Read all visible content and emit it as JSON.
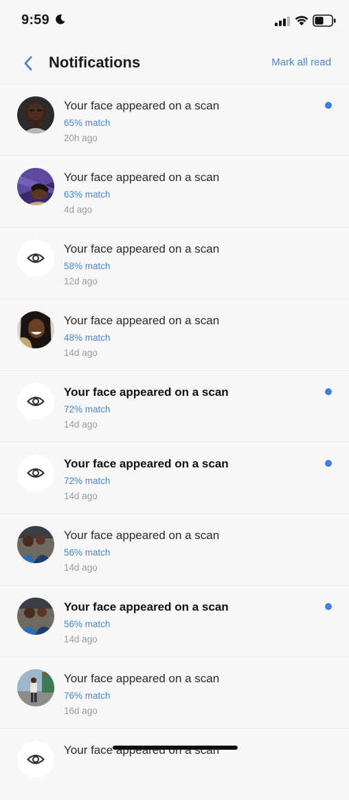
{
  "status_bar": {
    "time": "9:59"
  },
  "header": {
    "title": "Notifications",
    "mark_all_label": "Mark all read"
  },
  "colors": {
    "accent": "#4a86d9",
    "unread_dot": "#3d7fe0",
    "background": "#f7f7f8"
  },
  "notifications": [
    {
      "title": "Your face appeared on a scan",
      "match": "65% match",
      "time": "20h ago",
      "unread": true,
      "avatar": "photo-portrait-man"
    },
    {
      "title": "Your face appeared on a scan",
      "match": "63% match",
      "time": "4d ago",
      "unread": false,
      "avatar": "photo-portrait-woman-purple"
    },
    {
      "title": "Your face appeared on a scan",
      "match": "58% match",
      "time": "12d ago",
      "unread": false,
      "avatar": "eye-icon"
    },
    {
      "title": "Your face appeared on a scan",
      "match": "48% match",
      "time": "14d ago",
      "unread": false,
      "avatar": "photo-portrait-woman-selfie"
    },
    {
      "title": "Your face appeared on a scan",
      "match": "72% match",
      "time": "14d ago",
      "unread": true,
      "avatar": "eye-icon"
    },
    {
      "title": "Your face appeared on a scan",
      "match": "72% match",
      "time": "14d ago",
      "unread": true,
      "avatar": "eye-icon"
    },
    {
      "title": "Your face appeared on a scan",
      "match": "56% match",
      "time": "14d ago",
      "unread": false,
      "avatar": "photo-group-selfie"
    },
    {
      "title": "Your face appeared on a scan",
      "match": "56% match",
      "time": "14d ago",
      "unread": true,
      "avatar": "photo-group-selfie"
    },
    {
      "title": "Your face appeared on a scan",
      "match": "76% match",
      "time": "16d ago",
      "unread": false,
      "avatar": "photo-full-body"
    },
    {
      "title": "Your face appeared on a scan",
      "match": "",
      "time": "",
      "unread": false,
      "avatar": "eye-icon"
    }
  ]
}
